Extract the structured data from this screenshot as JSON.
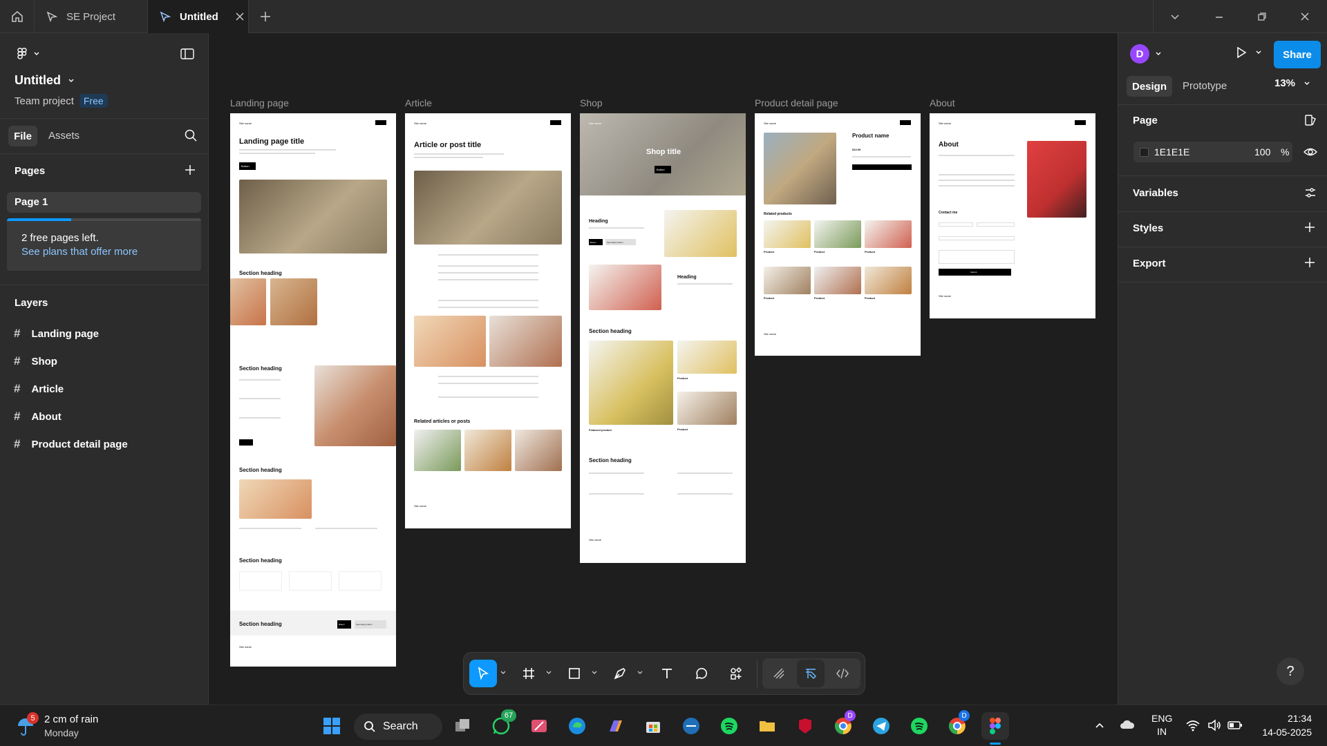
{
  "tabs": {
    "project_label": "SE Project",
    "active_label": "Untitled"
  },
  "left_panel": {
    "file_title": "Untitled",
    "team_label": "Team project",
    "plan_badge": "Free",
    "tab_file": "File",
    "tab_assets": "Assets",
    "pages_title": "Pages",
    "page_item": "Page 1",
    "free_pages_text": "2 free pages left.",
    "plans_link": "See plans that offer more",
    "free_pages_progress": 0.33,
    "layers_title": "Layers",
    "layers": [
      "Landing page",
      "Shop",
      "Article",
      "About",
      "Product detail page"
    ]
  },
  "right_panel": {
    "avatar_letter": "D",
    "share_label": "Share",
    "tab_design": "Design",
    "tab_prototype": "Prototype",
    "zoom": "13%",
    "page_title": "Page",
    "bg_hex": "1E1E1E",
    "bg_opacity": "100",
    "percent_sign": "%",
    "variables_label": "Variables",
    "styles_label": "Styles",
    "export_label": "Export"
  },
  "canvas": {
    "frames": [
      "Landing page",
      "Article",
      "Shop",
      "Product detail page",
      "About"
    ],
    "landing": {
      "logo": "Site name",
      "title": "Landing page title",
      "button": "Button",
      "section1": "Section heading",
      "section2": "Section heading",
      "section3": "Section heading",
      "section4": "Section heading",
      "cta_heading": "Section heading",
      "cta_button": "Button",
      "cta_secondary": "Secondary button",
      "footer_logo": "Site name"
    },
    "article": {
      "logo": "Site name",
      "title": "Article or post title",
      "related": "Related articles or posts",
      "footer_logo": "Site name"
    },
    "shop": {
      "logo": "Site name",
      "hero_title": "Shop title",
      "hero_button": "Button",
      "heading1": "Heading",
      "heading2": "Heading",
      "button": "Button",
      "secondary": "Secondary button",
      "section1": "Section heading",
      "section2": "Section heading",
      "featured": "Featured product",
      "product_a": "Product",
      "product_b": "Product",
      "footer_logo": "Site name"
    },
    "product": {
      "logo": "Site name",
      "title": "Product name",
      "price": "$10.99",
      "related": "Related products",
      "items": [
        "Product",
        "Product",
        "Product",
        "Product",
        "Product",
        "Product"
      ],
      "footer_logo": "Site name"
    },
    "about": {
      "logo": "Site name",
      "title": "About",
      "contact": "Contact me",
      "submit": "Submit",
      "footer_logo": "Site name"
    }
  },
  "taskbar": {
    "weather_badge": "5",
    "weather_text": "2 cm of rain",
    "weather_day": "Monday",
    "search_label": "Search",
    "whatsapp_badge": "67",
    "chrome_badge": "D",
    "lang1": "ENG",
    "lang2": "IN",
    "time": "21:34",
    "date": "14-05-2025"
  },
  "colors": {
    "accent": "#0d99ff",
    "panel": "#2c2c2c",
    "canvas": "#1e1e1e",
    "avatar": "#9747ff",
    "share": "#0c8ce9"
  }
}
